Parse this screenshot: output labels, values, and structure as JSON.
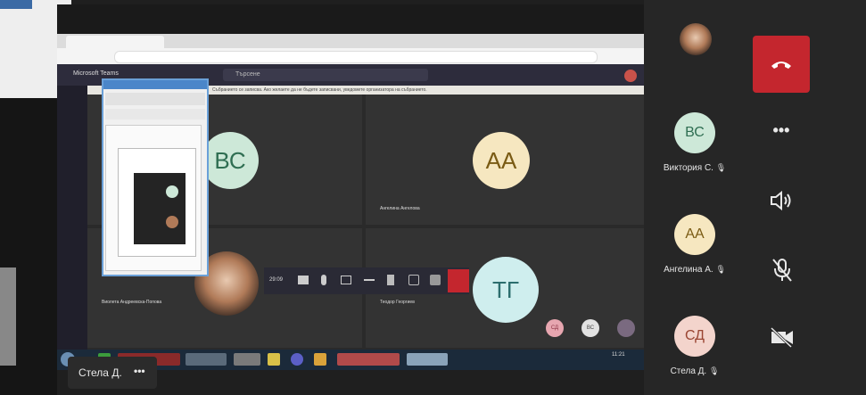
{
  "share": {
    "app_title": "Microsoft Teams",
    "search_placeholder": "Търсене",
    "notice_text": "Събранието се записва. Ако желаете да не бъдете записвани, уведомете организатора на събранието.",
    "participants": [
      {
        "initials": "ВС",
        "color": "#cde8d8",
        "text_color": "#2f6e52"
      },
      {
        "initials": "АА",
        "color": "#f6e7c0",
        "text_color": "#7a5b14",
        "label": "Ангелина Ангелова"
      },
      {
        "label": "Виолета Андреевска-Попова"
      },
      {
        "initials": "ТГ",
        "color": "#cfeeee",
        "text_color": "#2c6e6e",
        "label": "Теодор Георгиев"
      }
    ],
    "mini_badges": [
      {
        "initials": "СД",
        "color": "#e7a6b0"
      },
      {
        "initials": "ВС",
        "color": "#e2e2e2"
      }
    ],
    "call_timer": "29:09",
    "clock": "11:21"
  },
  "right_panel": {
    "participants": [
      {
        "initials": "ВС",
        "name": "Виктория С.",
        "color": "#cde8d8",
        "text_color": "#2f6e52"
      },
      {
        "initials": "АА",
        "name": "Ангелина А.",
        "color": "#f6e7c0",
        "text_color": "#7a5b14"
      },
      {
        "initials": "СД",
        "name": "Стела Д.",
        "color": "#f3d4cc",
        "text_color": "#9a4532"
      }
    ],
    "controls": {
      "more": "•••"
    }
  },
  "self_view": {
    "name": "Стела Д.",
    "more": "•••"
  },
  "colors": {
    "hangup": "#c4262e",
    "panel": "#262626"
  }
}
